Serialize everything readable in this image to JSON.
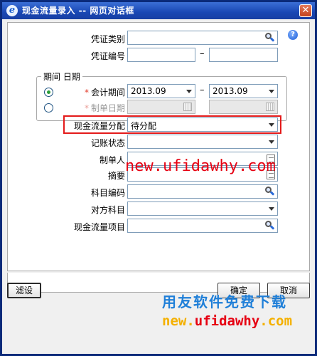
{
  "window": {
    "title": "现金流量录入 -- 网页对话框",
    "close_glyph": "✕",
    "app_icon_glyph": "e"
  },
  "help_glyph": "?",
  "fields": {
    "voucher_type": {
      "label": "凭证类别",
      "value": ""
    },
    "voucher_no": {
      "label": "凭证编号",
      "from": "",
      "to": "",
      "dash": "–"
    },
    "period_group_title": "期间 日期",
    "accounting_period": {
      "label": "会计期间",
      "required": "*",
      "from": "2013.09",
      "to": "2013.09",
      "selected": true
    },
    "entry_date": {
      "label": "制单日期",
      "required": "*",
      "from": "",
      "to": "",
      "selected": false
    },
    "cashflow_allocation": {
      "label": "现金流量分配",
      "value": "待分配"
    },
    "posting_status": {
      "label": "记账状态",
      "value": ""
    },
    "preparer": {
      "label": "制单人",
      "value": ""
    },
    "summary": {
      "label": "摘要",
      "value": ""
    },
    "account_code": {
      "label": "科目编码",
      "value": ""
    },
    "counter_account": {
      "label": "对方科目",
      "value": ""
    },
    "cashflow_item": {
      "label": "现金流量项目",
      "value": ""
    }
  },
  "buttons": {
    "filter": "滤设",
    "ok": "确定",
    "cancel": "取消"
  },
  "watermarks": {
    "url_red": "new.ufidawhy.com",
    "brand_cn": "用友软件免费下载",
    "url_bottom_a": "new.",
    "url_bottom_b": "ufidawhy",
    "url_bottom_c": ".com"
  },
  "colors": {
    "title_bar": "#1947b4",
    "highlight_border": "#e41a1a",
    "watermark_red": "#e60012",
    "watermark_blue": "#1f7fd8",
    "watermark_gold": "#f4b000"
  }
}
